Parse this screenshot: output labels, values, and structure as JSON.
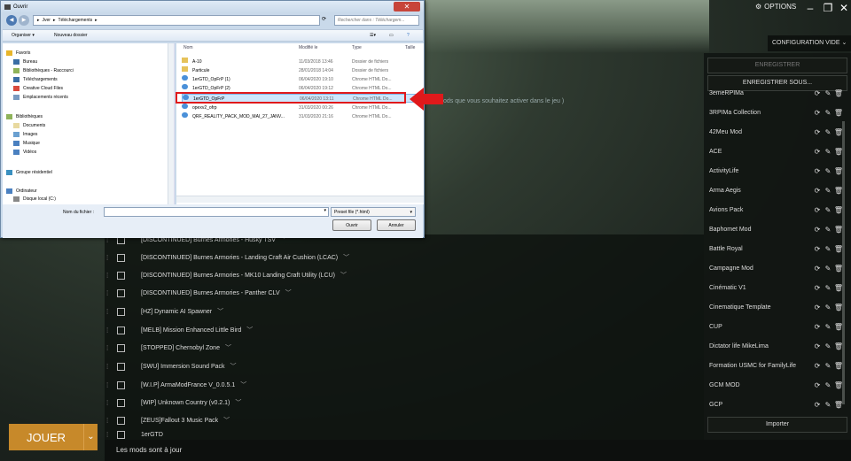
{
  "topbar": {
    "options_label": "OPTIONS",
    "window_buttons": [
      "–",
      "❐",
      "✕"
    ]
  },
  "config": {
    "label": "CONFIGURATION",
    "value": "VIDE"
  },
  "hint_text": "ods que vous souhaitez activer dans le jeu )",
  "mods": [
    {
      "name": "[DISCONTINUED] Burnes Armories - Husky TSV"
    },
    {
      "name": "[DISCONTINUED] Burnes Armories - Landing Craft Air Cushion (LCAC)"
    },
    {
      "name": "[DISCONTINUED] Burnes Armories - MK10 Landing Craft Utility (LCU)"
    },
    {
      "name": "[DISCONTINUED] Burnes Armories - Panther CLV"
    },
    {
      "name": "[HZ] Dynamic AI Spawner"
    },
    {
      "name": "[MELB] Mission Enhanced Little Bird"
    },
    {
      "name": "[STOPPED] Chernobyl Zone"
    },
    {
      "name": "[SWU] Immersion Sound Pack"
    },
    {
      "name": "[W.I.P] ArmaModFrance V_0.0.5.1"
    },
    {
      "name": "[WIP] Unknown Country (v0.2.1)"
    },
    {
      "name": "[ZEUS]Fallout 3 Music Pack"
    },
    {
      "name": "1erGTD"
    }
  ],
  "presets": {
    "save_label": "ENREGISTRER",
    "save_as_label": "ENREGISTRER SOUS...",
    "import_label": "Importer",
    "items": [
      "3emeRPIMa",
      "3RPIMa Collection",
      "42Meu Mod",
      "ACE",
      "ActivityLife",
      "Arma Aegis",
      "Avions Pack",
      "Baphomet Mod",
      "Battle Royal",
      "Campagne Mod",
      "Cinématic V1",
      "Cinematique Template",
      "CUP",
      "Dictator life MikeLima",
      "Formation USMC for FamilyLife",
      "GCM MOD",
      "GCP"
    ]
  },
  "play": {
    "label": "JOUER",
    "chevron": "⌄"
  },
  "status": "Les mods sont à jour",
  "dialog": {
    "title": "Ouvrir",
    "path": [
      "▸",
      "Jver",
      "▸",
      "Téléchargements",
      "▸"
    ],
    "search_placeholder": "Rechercher dans : Téléchargem...",
    "organize_label": "Organiser ▾",
    "new_folder_label": "Nouveau dossier",
    "nav": [
      {
        "label": "Favoris",
        "icon": "star-icon",
        "color": "#e8b52a"
      },
      {
        "label": "Bureau",
        "icon": "desktop-icon",
        "color": "#3a6ea5"
      },
      {
        "label": "Bibliothèques - Raccourci",
        "icon": "library-icon",
        "color": "#8fb35a"
      },
      {
        "label": "Téléchargements",
        "icon": "download-icon",
        "color": "#3a6ea5"
      },
      {
        "label": "Creative Cloud Files",
        "icon": "cloud-icon",
        "color": "#d94a3d"
      },
      {
        "label": "Emplacements récents",
        "icon": "recent-icon",
        "color": "#7a9ac0"
      },
      {
        "label": "Bibliothèques",
        "icon": "library-icon",
        "color": "#8fb35a"
      },
      {
        "label": "Documents",
        "icon": "documents-icon",
        "color": "#e8d9a0"
      },
      {
        "label": "Images",
        "icon": "images-icon",
        "color": "#6aa0d0"
      },
      {
        "label": "Musique",
        "icon": "music-icon",
        "color": "#4a80c0"
      },
      {
        "label": "Vidéos",
        "icon": "video-icon",
        "color": "#4a80c0"
      },
      {
        "label": "Groupe résidentiel",
        "icon": "homegroup-icon",
        "color": "#3a90c0"
      },
      {
        "label": "Ordinateur",
        "icon": "computer-icon",
        "color": "#4a80c0"
      },
      {
        "label": "Disque local (C:)",
        "icon": "disk-icon",
        "color": "#888888"
      }
    ],
    "columns": {
      "name": "Nom",
      "modified": "Modifié le",
      "type": "Type",
      "size": "Taille"
    },
    "files": [
      {
        "name": "A-10",
        "date": "11/03/2018 13:46",
        "type": "Dossier de fichiers",
        "kind": "folder"
      },
      {
        "name": "Particule",
        "date": "28/01/2018 14:04",
        "type": "Dossier de fichiers",
        "kind": "folder"
      },
      {
        "name": "1erGTD_OpFrP (1)",
        "date": "06/04/2020 19:10",
        "type": "Chrome HTML Do...",
        "kind": "html"
      },
      {
        "name": "1erGTD_OpFrP (2)",
        "date": "06/04/2020 19:12",
        "type": "Chrome HTML Do...",
        "kind": "html"
      },
      {
        "name": "1erGTD_OpFrP",
        "date": "06/04/2020 13:11",
        "type": "Chrome HTML Do...",
        "kind": "html"
      },
      {
        "name": "opexv2_ofrp",
        "date": "31/03/2020 00:26",
        "type": "Chrome HTML Do...",
        "kind": "html"
      },
      {
        "name": "QRF_REALITY_PACK_MOD_MAI_27_JANV...",
        "date": "31/03/2020 21:16",
        "type": "Chrome HTML Do...",
        "kind": "html"
      }
    ],
    "filename_label": "Nom du fichier :",
    "filetype_value": "Preset file (*.html)",
    "open_label": "Ouvrir",
    "cancel_label": "Annuler"
  }
}
